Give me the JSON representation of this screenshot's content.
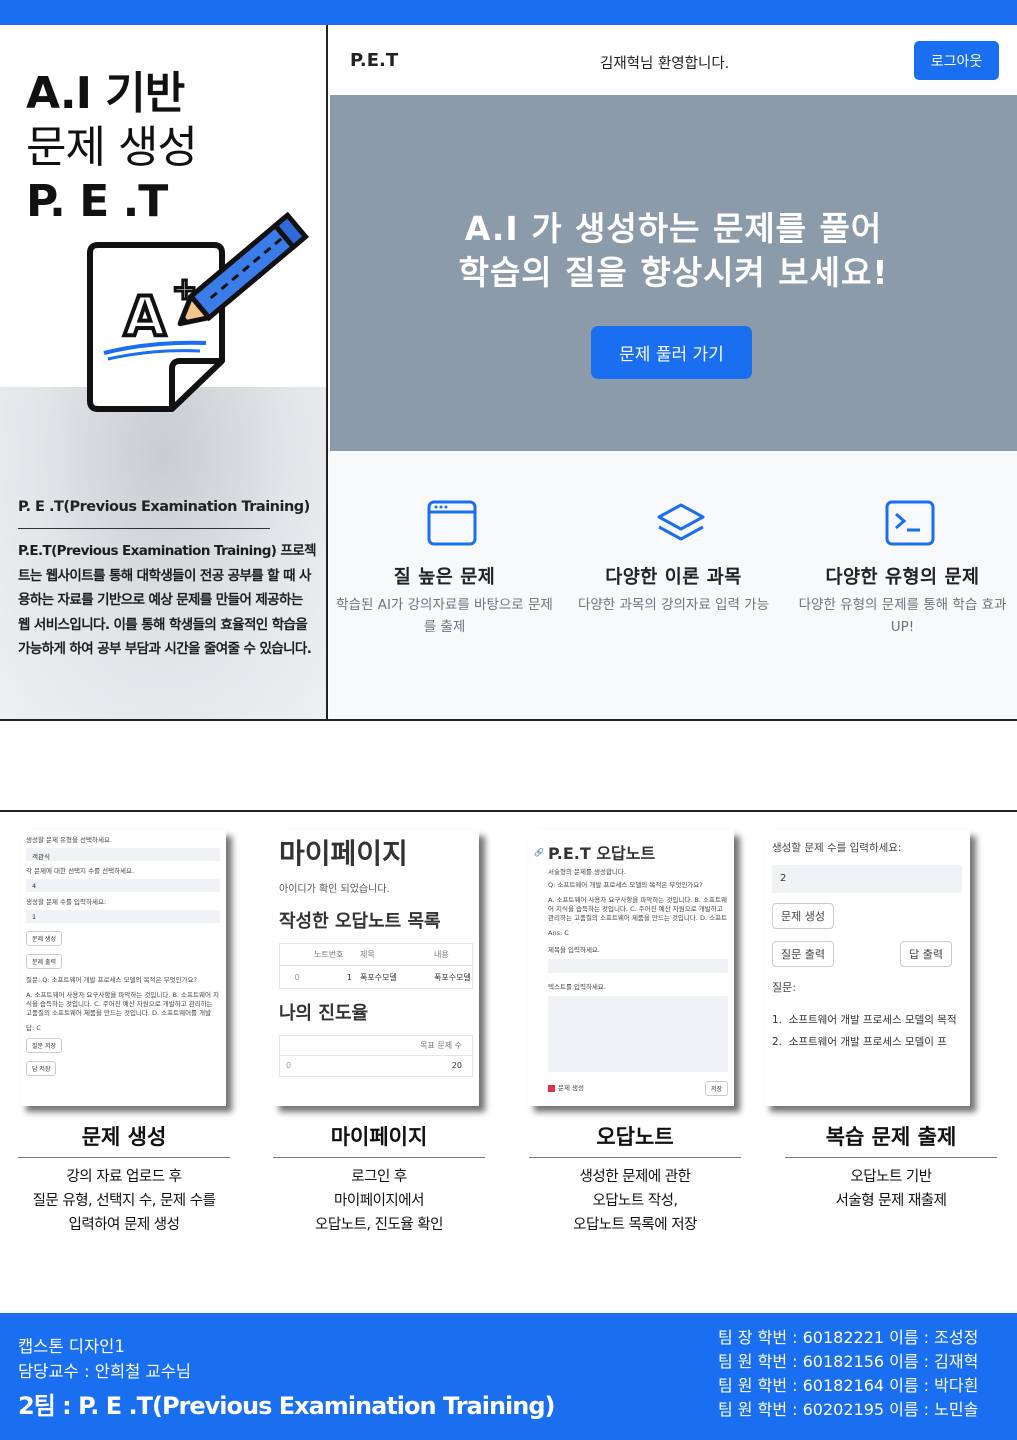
{
  "poster": {
    "title_line1": "A.I 기반",
    "title_line2": "문제 생성",
    "title_line3": "P. E .T",
    "about_heading": "P. E .T(Previous Examination Training)",
    "about_text": "P.E.T(Previous Examination Training) 프로젝트는 웹사이트를 통해 대학생들이 전공 공부를 할 때 사용하는 자료를 기반으로 예상 문제를 만들어 제공하는 웹 서비스입니다. 이를 통해 학생들의 효율적인 학습을 가능하게 하여 공부 부담과 시간을 줄여줄 수 있습니다."
  },
  "site": {
    "brand": "P.E.T",
    "welcome": "김재혁님 환영합니다.",
    "logout_label": "로그아웃",
    "hero_line1": "A.I 가 생성하는 문제를 풀어",
    "hero_line2": "학습의 질을 향상시켜 보세요!",
    "hero_button": "문제 풀러 가기",
    "features": [
      {
        "icon": "browser-window-icon",
        "title": "질 높은 문제",
        "desc": "학습된 AI가 강의자료를 바탕으로 문제를 출제"
      },
      {
        "icon": "layers-icon",
        "title": "다양한 이론 과목",
        "desc": "다양한 과목의 강의자료 입력 가능"
      },
      {
        "icon": "terminal-icon",
        "title": "다양한 유형의 문제",
        "desc": "다양한 유형의 문제를 통해 학습 효과 UP!"
      }
    ],
    "accent_color": "#1a6ff0",
    "hero_color": "#8c9baa"
  },
  "cards": {
    "gen": {
      "l1": "생성할 문제 유형을 선택하세요.",
      "v1": "객관식",
      "l2": "각 문제에 대한 선택지 수를 선택하세요.",
      "v2": "4",
      "l3": "생성할 문제 수를 입력하세요:",
      "v3": "1",
      "b1": "문제 생성",
      "b2": "문제 출력",
      "q": "질문: Q: 소프트웨어 개발 프로세스 모델의 목적은 무엇인가요?",
      "opts": "A. 소프트웨어 사용자 요구사항을 파악하는 것입니다. B. 소프트웨어 지식을 습득하는 것입니다. C. 주어진 예산 자원으로 개발하고 관리하는 고품질의 소프트웨어 제품을 만드는 것입니다. D. 소프트웨어를 개발",
      "ans": "답: C",
      "b3": "질문 저장",
      "b4": "답 저장"
    },
    "my": {
      "title": "마이페이지",
      "confirm": "아이디가 확인 되었습니다.",
      "list_title": "작성한 오답노트 목록",
      "col_no": "노트번호",
      "col_title": "제목",
      "col_content": "내용",
      "row_idx": "0",
      "row_no": "1",
      "row_title": "폭포수모델",
      "row_content": "폭포수모델",
      "progress_title": "나의 진도율",
      "col_goal": "목표 문제 수",
      "goal_idx": "0",
      "goal_val": "20"
    },
    "note": {
      "title": "P.E.T 오답노트",
      "sub": "서술형의 문제를 생성합니다.",
      "q": "Q: 소프트웨어 개발 프로세스 모델의 목적은 무엇인가요?",
      "opts": "A. 소프트웨어 사용자 요구사항을 파악하는 것입니다. B. 소프트웨어 지식을 습득하는 것입니다. C. 주어진 예산 자원으로 개발하고 관리하는 고품질의 소프트웨어 제품을 만드는 것입니다. D. 소프트웨어를 개발",
      "ans": "Ans: C",
      "l_title": "제목을 입력하세요.",
      "l_text": "텍스트를 입력하세요.",
      "check": "문제 생성",
      "save": "저장"
    },
    "review": {
      "label": "생성할 문제 수를 입력하세요:",
      "value": "2",
      "b1": "문제 생성",
      "b2": "질문 출력",
      "b3": "답 출력",
      "q_label": "질문:",
      "q1": "소프트웨어 개발 프로세스 모델의 목적",
      "q2": "소프트웨어 개발 프로세스 모델이 프"
    }
  },
  "sections": [
    {
      "title": "문제 생성",
      "desc1": "강의 자료 업로드 후",
      "desc2": "질문 유형, 선택지 수, 문제 수를",
      "desc3": "입력하여 문제 생성"
    },
    {
      "title": "마이페이지",
      "desc1": "로그인 후",
      "desc2": "마이페이지에서",
      "desc3": "오답노트, 진도율 확인"
    },
    {
      "title": "오답노트",
      "desc1": "생성한 문제에 관한",
      "desc2": "오답노트 작성,",
      "desc3": "오답노트 목록에 저장"
    },
    {
      "title": "복습 문제 출제",
      "desc1": "오답노트 기반",
      "desc2": "서술형 문제 재출제",
      "desc3": ""
    }
  ],
  "footer": {
    "course": "캡스톤 디자인1",
    "professor": "담당교수 : 안희철 교수님",
    "team": "2팀  :  P. E .T(Previous Examination Training)",
    "members": [
      "팀 장 학번 : 60182221 이름 : 조성정",
      "팀 원 학번 : 60182156 이름 : 김재혁",
      "팀 원 학번 : 60182164 이름 : 박다흰",
      "팀 원 학번 : 60202195 이름 : 노민솔"
    ]
  }
}
